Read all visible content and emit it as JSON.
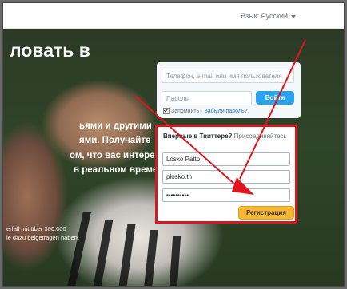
{
  "topbar": {
    "language_label": "Язык: Русский"
  },
  "hero": {
    "welcome_text": "ловать в",
    "lines": [
      "ьями и другими",
      "ями. Получайте",
      "ом, что вас интересует. И",
      "в реальном времени, с"
    ],
    "german_lines": [
      "erfall mit über 300.000",
      "ie dazu beigetragen haben."
    ]
  },
  "login": {
    "username_placeholder": "Телефон, e-mail или имя пользователя",
    "password_placeholder": "Пароль",
    "login_button": "Войти",
    "remember_label": "Запомнить",
    "separator": "·",
    "forgot_link": "Забыли пароль?"
  },
  "signup": {
    "title_bold": "Впервые в Твиттере?",
    "title_join": "Присоединяйтесь",
    "name_value": "Losko Patto",
    "email_value": "plosko.th",
    "password_value": "••••••••••",
    "register_button": "Регистрация"
  },
  "annotation_color": "#e0141c"
}
